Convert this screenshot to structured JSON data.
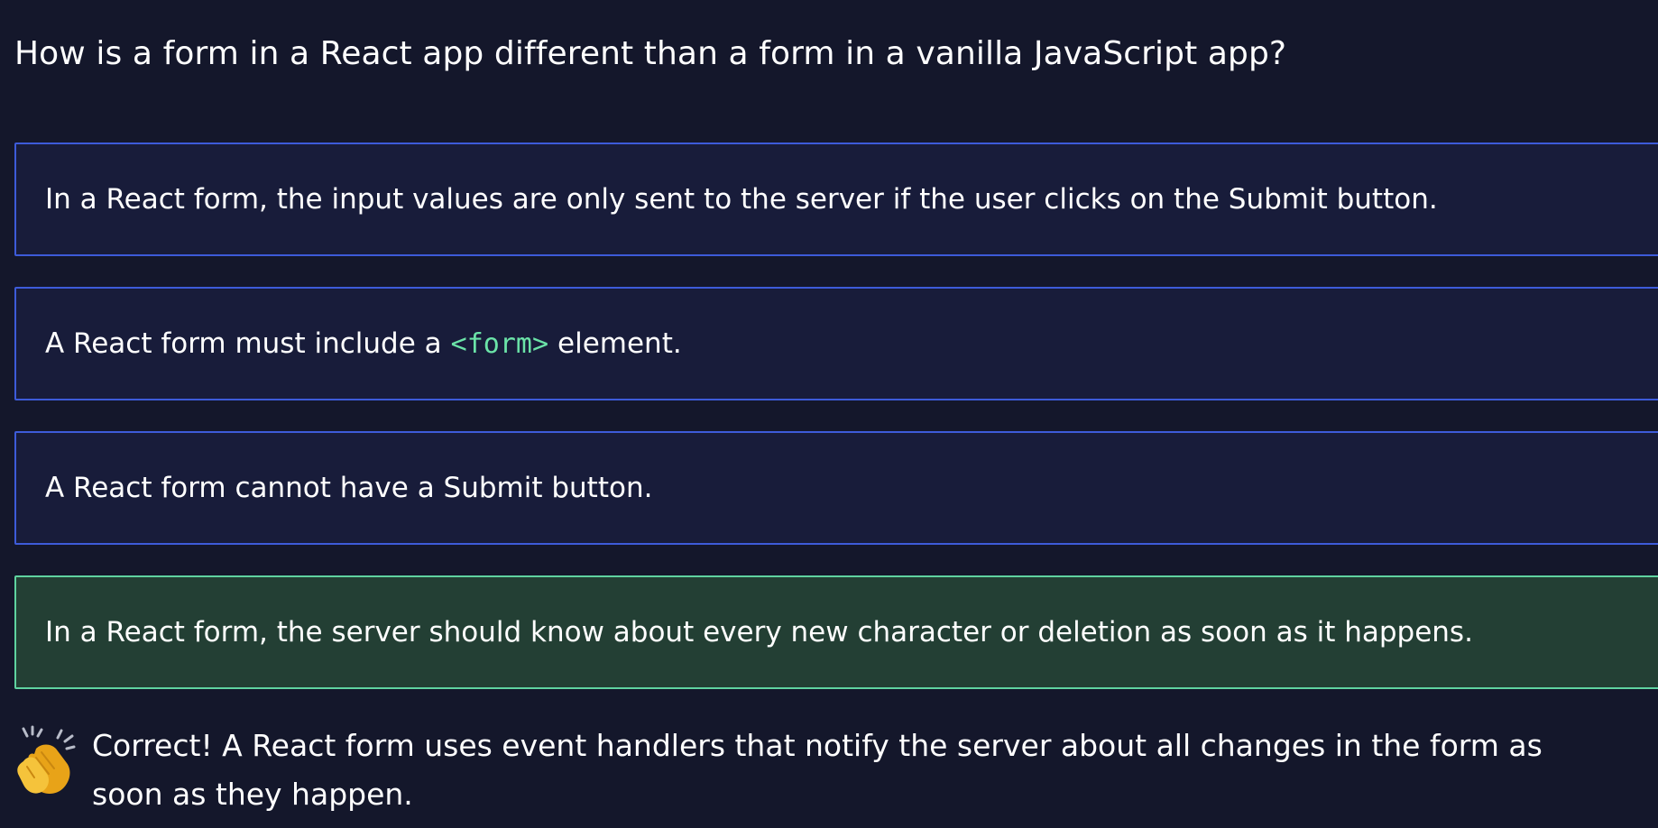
{
  "question": "How is a form in a React app different than a form in a vanilla JavaScript app?",
  "options": [
    {
      "text": "In a React form, the input values are only sent to the server if the user clicks on the Submit button.",
      "state": "default"
    },
    {
      "text_before": "A React form must include a",
      "code": "<form>",
      "text_after": "element.",
      "state": "default"
    },
    {
      "text": "A React form cannot have a Submit button.",
      "state": "default"
    },
    {
      "text": "In a React form, the server should know about every new character or deletion as soon as it happens.",
      "state": "correct"
    }
  ],
  "feedback": {
    "icon": "clapping-hands-icon",
    "text": "Correct! A React form uses event handlers that notify the server about all changes in the form as soon as they happen."
  },
  "colors": {
    "background": "#14172b",
    "option_border": "#3d5bd9",
    "option_background": "#181c3a",
    "correct_border": "#5fd3a0",
    "correct_background": "#233f34",
    "code_text": "#6be3a8"
  }
}
